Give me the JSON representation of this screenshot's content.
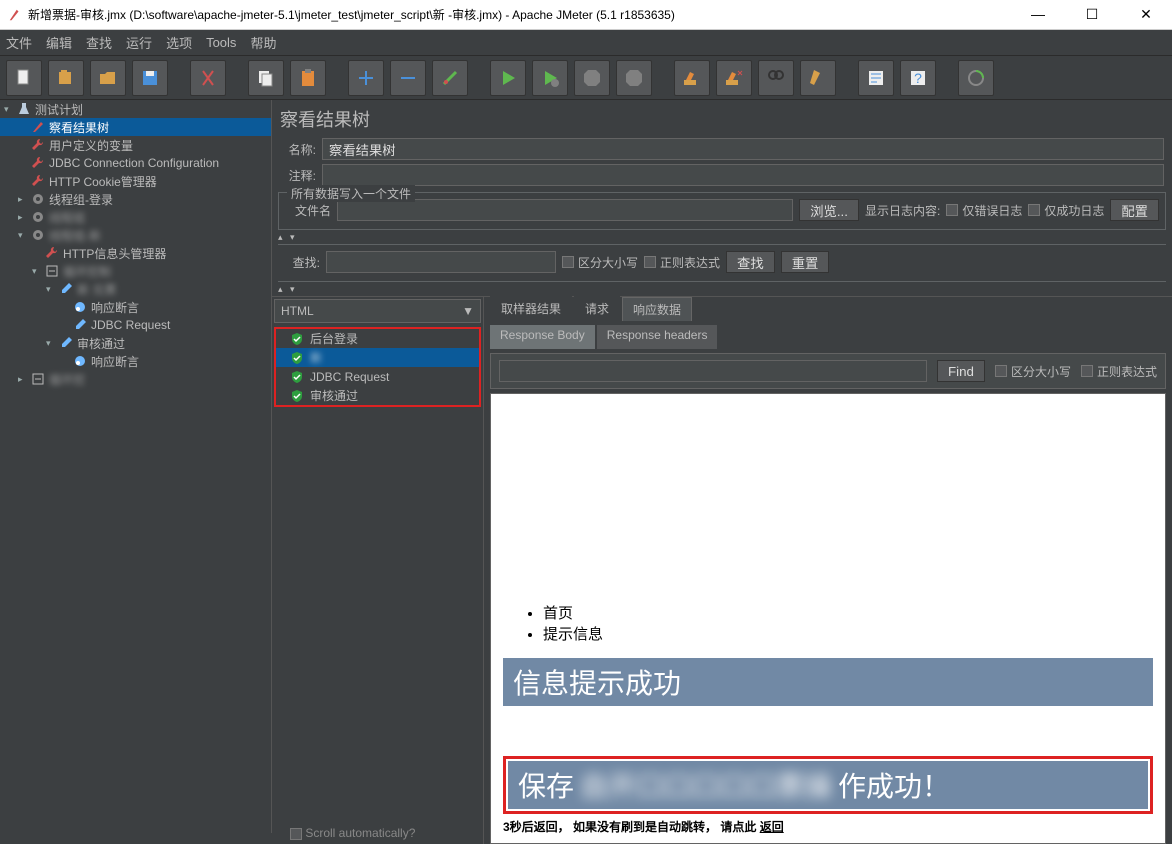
{
  "window": {
    "title": "新增票据-审核.jmx (D:\\software\\apache-jmeter-5.1\\jmeter_test\\jmeter_script\\新          -审核.jmx) - Apache JMeter (5.1 r1853635)"
  },
  "menubar": [
    "文件",
    "编辑",
    "查找",
    "运行",
    "选项",
    "Tools",
    "帮助"
  ],
  "tree": [
    {
      "label": "测试计划",
      "indent": 0,
      "exp": "▾",
      "icon": "flask"
    },
    {
      "label": "察看结果树",
      "indent": 1,
      "sel": true,
      "icon": "feather"
    },
    {
      "label": "用户定义的变量",
      "indent": 1,
      "icon": "wrench"
    },
    {
      "label": "JDBC Connection Configuration",
      "indent": 1,
      "icon": "wrench"
    },
    {
      "label": "HTTP Cookie管理器",
      "indent": 1,
      "icon": "wrench"
    },
    {
      "label": "线程组-登录",
      "indent": 1,
      "exp": "▸",
      "icon": "gear"
    },
    {
      "label": "线程组",
      "indent": 1,
      "exp": "▸",
      "icon": "gear",
      "blur": true
    },
    {
      "label": "线程组-新",
      "indent": 1,
      "exp": "▾",
      "icon": "gear",
      "blur": true
    },
    {
      "label": "HTTP信息头管理器",
      "indent": 2,
      "icon": "wrench"
    },
    {
      "label": "循环控制",
      "indent": 2,
      "exp": "▾",
      "icon": "loop",
      "blur": true
    },
    {
      "label": "新             兑票",
      "indent": 3,
      "exp": "▾",
      "icon": "dropper",
      "blur": true
    },
    {
      "label": "响应断言",
      "indent": 4,
      "icon": "assert"
    },
    {
      "label": "JDBC Request",
      "indent": 4,
      "icon": "dropper"
    },
    {
      "label": "审核通过",
      "indent": 3,
      "exp": "▾",
      "icon": "dropper"
    },
    {
      "label": "响应断言",
      "indent": 4,
      "icon": "assert"
    },
    {
      "label": "循环控",
      "indent": 1,
      "exp": "▸",
      "icon": "loop",
      "blur": true
    }
  ],
  "panel": {
    "title": "察看结果树",
    "name_label": "名称:",
    "name_value": "察看结果树",
    "comment_label": "注释:",
    "comment_value": "",
    "file_legend": "所有数据写入一个文件",
    "filename_label": "文件名",
    "browse_btn": "浏览...",
    "showlog_label": "显示日志内容:",
    "errors_only": "仅错误日志",
    "success_only": "仅成功日志",
    "configure_btn": "配置",
    "search_label": "查找:",
    "case_sensitive": "区分大小写",
    "regex": "正则表达式",
    "search_btn": "查找",
    "reset_btn": "重置"
  },
  "results": {
    "renderer": "HTML",
    "items": [
      {
        "label": "后台登录"
      },
      {
        "label": "新",
        "sel": true,
        "blur": true
      },
      {
        "label": "JDBC Request"
      },
      {
        "label": "审核通过"
      }
    ],
    "scroll_auto": "Scroll automatically?"
  },
  "detail": {
    "tabs": [
      "取样器结果",
      "请求",
      "响应数据"
    ],
    "active_tab": 2,
    "subtabs": [
      "Response Body",
      "Response headers"
    ],
    "active_subtab": 0,
    "find_btn": "Find",
    "case_sensitive": "区分大小写",
    "regex": "正则表达式",
    "body": {
      "list": [
        "首页",
        "提示信息"
      ],
      "banner1": "信息提示成功",
      "banner2_pre": "保存",
      "banner2_post": "作成功！",
      "footnote_pre": "3秒后返回，  如果没有刷到是自动跳转， 请点此 ",
      "footnote_link": "返回"
    }
  }
}
